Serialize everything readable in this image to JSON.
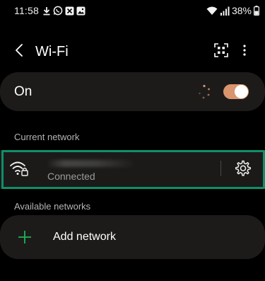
{
  "status_bar": {
    "time": "11:58",
    "battery": "38%",
    "notification_icons": [
      "download-icon",
      "whatsapp-icon",
      "x-icon",
      "image-icon"
    ],
    "system_icons": [
      "wifi-icon",
      "signal-icon",
      "battery-icon"
    ]
  },
  "header": {
    "title": "Wi-Fi",
    "icons": [
      "back-icon",
      "qr-code-icon",
      "more-icon"
    ]
  },
  "wifi_toggle": {
    "label": "On",
    "enabled": true,
    "accent": "#d8956e"
  },
  "current_network": {
    "section_label": "Current network",
    "status": "Connected",
    "highlight_color": "#0f8f6a"
  },
  "available_networks": {
    "section_label": "Available networks",
    "add_label": "Add network",
    "plus_color": "#1fb35b"
  }
}
